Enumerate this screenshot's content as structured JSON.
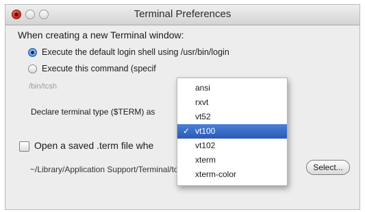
{
  "window": {
    "title": "Terminal Preferences"
  },
  "section": {
    "heading": "When creating a new Terminal window:",
    "option_login": "Execute the default login shell using /usr/bin/login",
    "option_command": "Execute this command (specif",
    "command_value": "/bin/tcsh"
  },
  "declare": {
    "label": "Declare terminal type ($TERM) as"
  },
  "term_menu": {
    "items": [
      "ansi",
      "rxvt",
      "vt52",
      "vt100",
      "vt102",
      "xterm",
      "xterm-color"
    ],
    "selected": "vt100",
    "check_glyph": "✓"
  },
  "saved_term": {
    "label": "Open a saved .term file whe",
    "path": "~/Library/Application Support/Terminal/toplist.term",
    "select_button": "Select..."
  }
}
